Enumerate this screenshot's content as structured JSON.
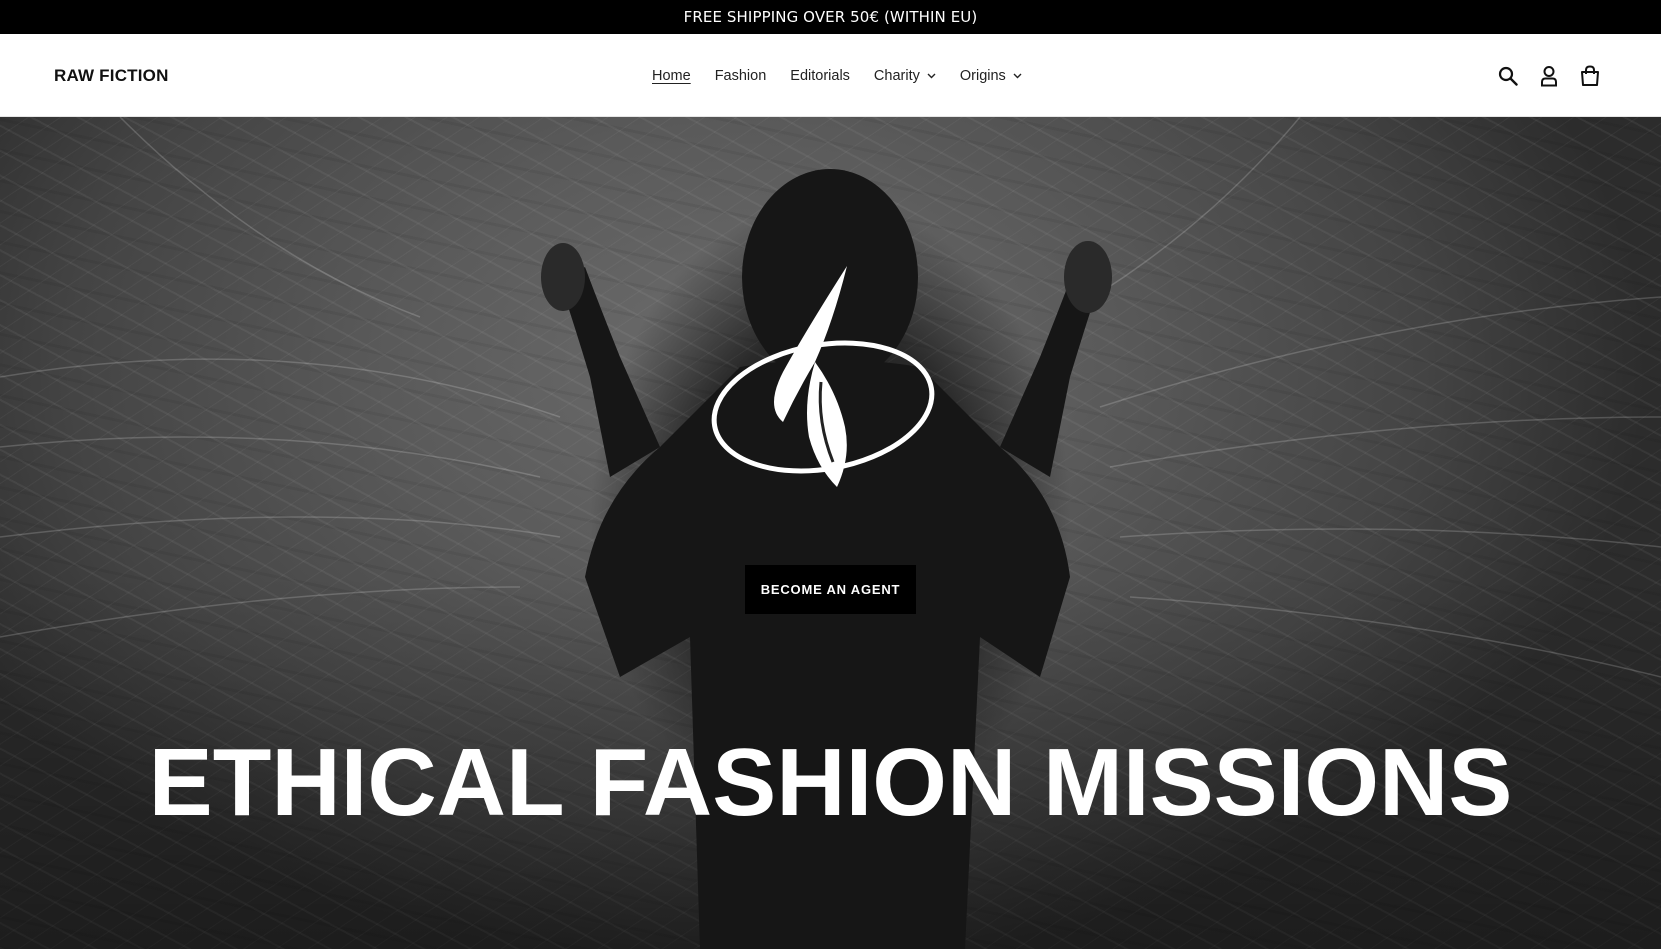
{
  "announcement": {
    "text": "FREE SHIPPING OVER 50€ (WITHIN EU)"
  },
  "header": {
    "logo": "RAW FICTION",
    "nav": [
      {
        "label": "Home",
        "active": true,
        "has_dropdown": false
      },
      {
        "label": "Fashion",
        "active": false,
        "has_dropdown": false
      },
      {
        "label": "Editorials",
        "active": false,
        "has_dropdown": false
      },
      {
        "label": "Charity",
        "active": false,
        "has_dropdown": true
      },
      {
        "label": "Origins",
        "active": false,
        "has_dropdown": true
      }
    ],
    "icons": [
      "search-icon",
      "account-icon",
      "cart-icon"
    ]
  },
  "hero": {
    "cta_label": "BECOME AN AGENT",
    "headline": "ETHICAL FASHION MISSIONS",
    "mark": "raw-fiction-leaf-logo"
  },
  "colors": {
    "announcement_bg": "#000000",
    "header_bg": "#ffffff",
    "cta_bg": "#000000",
    "headline_text": "#ffffff"
  }
}
